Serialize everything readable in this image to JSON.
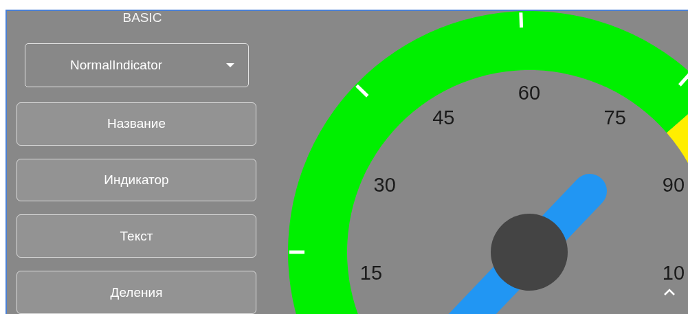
{
  "panel": {
    "heading": "BASIC",
    "dropdown": {
      "value": "NormalIndicator"
    },
    "buttons": [
      "Название",
      "Индикатор",
      "Текст",
      "Деления"
    ]
  },
  "gauge": {
    "scale_labels": [
      "15",
      "30",
      "45",
      "60",
      "75",
      "90",
      "10"
    ]
  }
}
